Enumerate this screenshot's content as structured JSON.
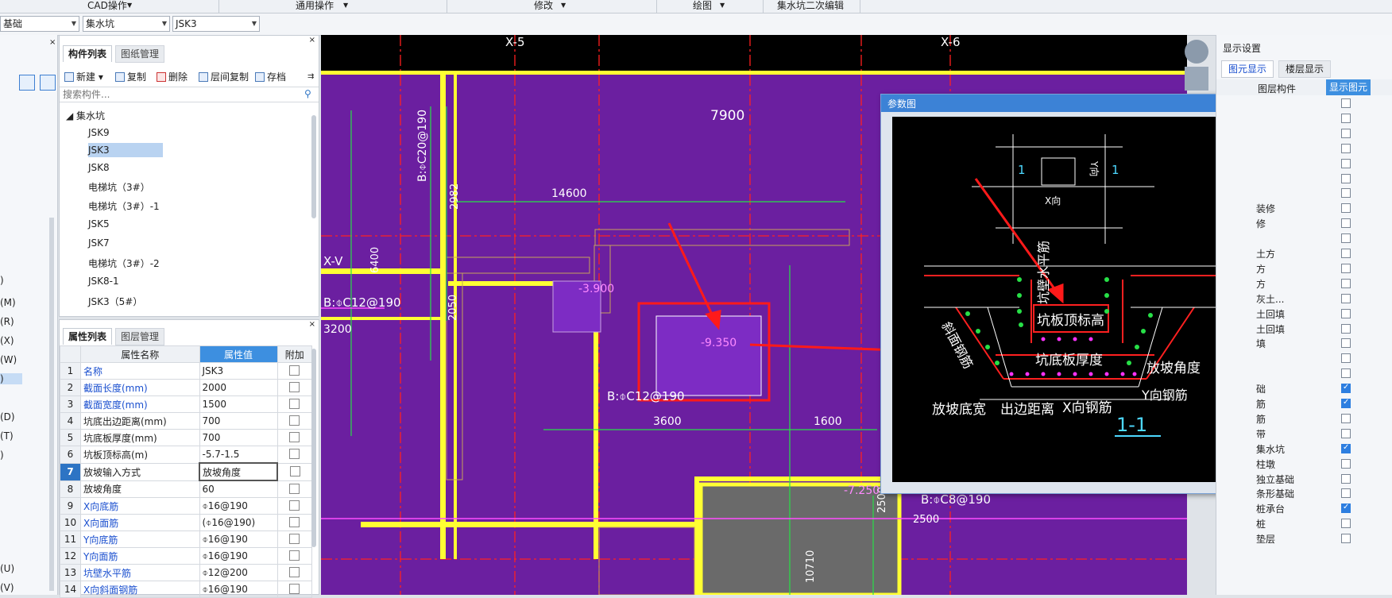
{
  "menubar": {
    "items": [
      "CAD操作",
      "通用操作",
      "修改",
      "绘图",
      "集水坑二次编辑"
    ]
  },
  "toolbar": {
    "select_1": "基础",
    "select_2": "集水坑",
    "select_3": "JSK3"
  },
  "left_panel": {
    "items": [
      ")",
      "(M)",
      "(R)",
      "(X)",
      "(W)",
      ")",
      "(D)",
      "(T)",
      ")",
      "(U)",
      "(V)"
    ]
  },
  "component_list": {
    "tabs": [
      "构件列表",
      "图纸管理"
    ],
    "toolbar": {
      "new": "新建",
      "copy": "复制",
      "delete": "删除",
      "floor_copy": "层间复制",
      "save": "存档"
    },
    "search_placeholder": "搜索构件...",
    "tree_root": "集水坑",
    "tree_items": [
      "JSK9",
      "JSK3",
      "JSK8",
      "电梯坑（3#）",
      "电梯坑（3#）-1",
      "JSK5",
      "JSK7",
      "电梯坑（3#）-2",
      "JSK8-1",
      "JSK3（5#）"
    ],
    "selected": "JSK3"
  },
  "attributes": {
    "tabs": [
      "属性列表",
      "图层管理"
    ],
    "headers": [
      "属性名称",
      "属性值",
      "附加"
    ],
    "rows": [
      {
        "num": "1",
        "name": "名称",
        "value": "JSK3",
        "blue": true
      },
      {
        "num": "2",
        "name": "截面长度(mm)",
        "value": "2000",
        "blue": true
      },
      {
        "num": "3",
        "name": "截面宽度(mm)",
        "value": "1500",
        "blue": true
      },
      {
        "num": "4",
        "name": "坑底出边距离(mm)",
        "value": "700",
        "blue": false
      },
      {
        "num": "5",
        "name": "坑底板厚度(mm)",
        "value": "700",
        "blue": false
      },
      {
        "num": "6",
        "name": "坑板顶标高(m)",
        "value": "-5.7-1.5",
        "blue": false
      },
      {
        "num": "7",
        "name": "放坡输入方式",
        "value": "放坡角度",
        "blue": false
      },
      {
        "num": "8",
        "name": "放坡角度",
        "value": "60",
        "blue": false
      },
      {
        "num": "9",
        "name": "X向底筋",
        "value": "⌽16@190",
        "blue": true
      },
      {
        "num": "10",
        "name": "X向面筋",
        "value": "(⌽16@190)",
        "blue": true
      },
      {
        "num": "11",
        "name": "Y向底筋",
        "value": "⌽16@190",
        "blue": true
      },
      {
        "num": "12",
        "name": "Y向面筋",
        "value": "⌽16@190",
        "blue": true
      },
      {
        "num": "13",
        "name": "坑壁水平筋",
        "value": "⌽12@200",
        "blue": true
      },
      {
        "num": "14",
        "name": "X向斜面钢筋",
        "value": "⌽16@190",
        "blue": true
      }
    ],
    "selected_row": "7"
  },
  "canvas": {
    "labels": {
      "axis_x5": "X-5",
      "axis_x6": "X-6",
      "axis_xv": "X-V",
      "dim_7900": "7900",
      "dim_14600": "14600",
      "dim_2982": "2982",
      "dim_6400": "6400",
      "dim_3200": "3200",
      "dim_2050": "2050",
      "dim_3600": "3600",
      "dim_1600": "1600",
      "dim_2500": "2500",
      "dim_2500b": "2500",
      "dim_10710": "10710",
      "rebar_1": "B:⌽C20@190",
      "rebar_2": "B:⌽C12@190",
      "rebar_3": "B:⌽C12@190",
      "rebar_4": "B:⌽C8@190",
      "elev_1": "-3.900",
      "elev_2": "-9.350",
      "elev_3": "-7.250"
    }
  },
  "dialog": {
    "title": "参数图",
    "close": "×",
    "labels": {
      "sec_left": "1",
      "sec_right": "1",
      "y_dir": "Y向",
      "x_dir": "X向",
      "wall_bar": "坑壁水平筋",
      "top_elev": "坑板顶标高",
      "slope_bar": "斜面钢筋",
      "bottom_thk": "坑底板厚度",
      "slope_angle": "放坡角度",
      "y_bar": "Y向钢筋",
      "slope_width": "放坡底宽",
      "edge_dist": "出边距离",
      "x_bar": "X向钢筋",
      "section": "1-1"
    }
  },
  "right_panel": {
    "title": "显示设置",
    "tabs": [
      "图元显示",
      "楼层显示"
    ],
    "headers": [
      "图层构件",
      "显示图元"
    ],
    "rows": [
      {
        "label": "",
        "checked": false
      },
      {
        "label": "",
        "checked": false
      },
      {
        "label": "",
        "checked": false
      },
      {
        "label": "",
        "checked": false
      },
      {
        "label": "",
        "checked": false
      },
      {
        "label": "",
        "checked": false
      },
      {
        "label": "",
        "checked": false
      },
      {
        "label": "装修",
        "checked": false
      },
      {
        "label": "修",
        "checked": false
      },
      {
        "label": "",
        "checked": false
      },
      {
        "label": "土方",
        "checked": false
      },
      {
        "label": "方",
        "checked": false
      },
      {
        "label": "方",
        "checked": false
      },
      {
        "label": "灰土...",
        "checked": false
      },
      {
        "label": "土回填",
        "checked": false
      },
      {
        "label": "土回填",
        "checked": false
      },
      {
        "label": "填",
        "checked": false
      },
      {
        "label": "",
        "checked": false
      },
      {
        "label": "",
        "checked": false
      },
      {
        "label": "础",
        "checked": true
      },
      {
        "label": "筋",
        "checked": true
      },
      {
        "label": "筋",
        "checked": false
      },
      {
        "label": "带",
        "checked": false
      },
      {
        "label": "集水坑",
        "checked": true
      },
      {
        "label": "柱墩",
        "checked": false
      },
      {
        "label": "独立基础",
        "checked": false
      },
      {
        "label": "条形基础",
        "checked": false
      },
      {
        "label": "桩承台",
        "checked": true
      },
      {
        "label": "桩",
        "checked": false
      },
      {
        "label": "垫层",
        "checked": false
      }
    ]
  },
  "colors": {
    "canvas_purple": "#6b1fa0",
    "axis_red": "#ff2020",
    "beam_yellow": "#ffff33",
    "dim_green": "#27e047",
    "highlight_red": "#ff1a1a",
    "dialog_title": "#3c82d6",
    "tab_blue": "#3d8fe0"
  }
}
